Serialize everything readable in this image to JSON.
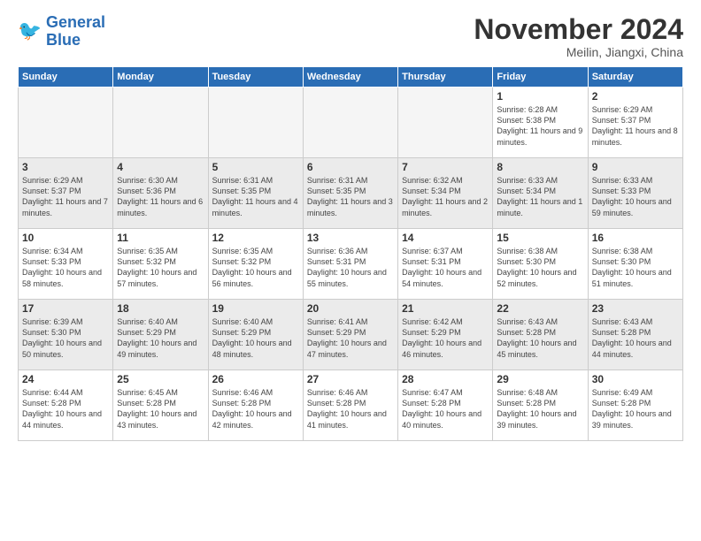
{
  "logo": {
    "line1": "General",
    "line2": "Blue"
  },
  "title": "November 2024",
  "location": "Meilin, Jiangxi, China",
  "weekdays": [
    "Sunday",
    "Monday",
    "Tuesday",
    "Wednesday",
    "Thursday",
    "Friday",
    "Saturday"
  ],
  "weeks": [
    [
      {
        "day": "",
        "text": ""
      },
      {
        "day": "",
        "text": ""
      },
      {
        "day": "",
        "text": ""
      },
      {
        "day": "",
        "text": ""
      },
      {
        "day": "",
        "text": ""
      },
      {
        "day": "1",
        "text": "Sunrise: 6:28 AM\nSunset: 5:38 PM\nDaylight: 11 hours and 9 minutes."
      },
      {
        "day": "2",
        "text": "Sunrise: 6:29 AM\nSunset: 5:37 PM\nDaylight: 11 hours and 8 minutes."
      }
    ],
    [
      {
        "day": "3",
        "text": "Sunrise: 6:29 AM\nSunset: 5:37 PM\nDaylight: 11 hours and 7 minutes."
      },
      {
        "day": "4",
        "text": "Sunrise: 6:30 AM\nSunset: 5:36 PM\nDaylight: 11 hours and 6 minutes."
      },
      {
        "day": "5",
        "text": "Sunrise: 6:31 AM\nSunset: 5:35 PM\nDaylight: 11 hours and 4 minutes."
      },
      {
        "day": "6",
        "text": "Sunrise: 6:31 AM\nSunset: 5:35 PM\nDaylight: 11 hours and 3 minutes."
      },
      {
        "day": "7",
        "text": "Sunrise: 6:32 AM\nSunset: 5:34 PM\nDaylight: 11 hours and 2 minutes."
      },
      {
        "day": "8",
        "text": "Sunrise: 6:33 AM\nSunset: 5:34 PM\nDaylight: 11 hours and 1 minute."
      },
      {
        "day": "9",
        "text": "Sunrise: 6:33 AM\nSunset: 5:33 PM\nDaylight: 10 hours and 59 minutes."
      }
    ],
    [
      {
        "day": "10",
        "text": "Sunrise: 6:34 AM\nSunset: 5:33 PM\nDaylight: 10 hours and 58 minutes."
      },
      {
        "day": "11",
        "text": "Sunrise: 6:35 AM\nSunset: 5:32 PM\nDaylight: 10 hours and 57 minutes."
      },
      {
        "day": "12",
        "text": "Sunrise: 6:35 AM\nSunset: 5:32 PM\nDaylight: 10 hours and 56 minutes."
      },
      {
        "day": "13",
        "text": "Sunrise: 6:36 AM\nSunset: 5:31 PM\nDaylight: 10 hours and 55 minutes."
      },
      {
        "day": "14",
        "text": "Sunrise: 6:37 AM\nSunset: 5:31 PM\nDaylight: 10 hours and 54 minutes."
      },
      {
        "day": "15",
        "text": "Sunrise: 6:38 AM\nSunset: 5:30 PM\nDaylight: 10 hours and 52 minutes."
      },
      {
        "day": "16",
        "text": "Sunrise: 6:38 AM\nSunset: 5:30 PM\nDaylight: 10 hours and 51 minutes."
      }
    ],
    [
      {
        "day": "17",
        "text": "Sunrise: 6:39 AM\nSunset: 5:30 PM\nDaylight: 10 hours and 50 minutes."
      },
      {
        "day": "18",
        "text": "Sunrise: 6:40 AM\nSunset: 5:29 PM\nDaylight: 10 hours and 49 minutes."
      },
      {
        "day": "19",
        "text": "Sunrise: 6:40 AM\nSunset: 5:29 PM\nDaylight: 10 hours and 48 minutes."
      },
      {
        "day": "20",
        "text": "Sunrise: 6:41 AM\nSunset: 5:29 PM\nDaylight: 10 hours and 47 minutes."
      },
      {
        "day": "21",
        "text": "Sunrise: 6:42 AM\nSunset: 5:29 PM\nDaylight: 10 hours and 46 minutes."
      },
      {
        "day": "22",
        "text": "Sunrise: 6:43 AM\nSunset: 5:28 PM\nDaylight: 10 hours and 45 minutes."
      },
      {
        "day": "23",
        "text": "Sunrise: 6:43 AM\nSunset: 5:28 PM\nDaylight: 10 hours and 44 minutes."
      }
    ],
    [
      {
        "day": "24",
        "text": "Sunrise: 6:44 AM\nSunset: 5:28 PM\nDaylight: 10 hours and 44 minutes."
      },
      {
        "day": "25",
        "text": "Sunrise: 6:45 AM\nSunset: 5:28 PM\nDaylight: 10 hours and 43 minutes."
      },
      {
        "day": "26",
        "text": "Sunrise: 6:46 AM\nSunset: 5:28 PM\nDaylight: 10 hours and 42 minutes."
      },
      {
        "day": "27",
        "text": "Sunrise: 6:46 AM\nSunset: 5:28 PM\nDaylight: 10 hours and 41 minutes."
      },
      {
        "day": "28",
        "text": "Sunrise: 6:47 AM\nSunset: 5:28 PM\nDaylight: 10 hours and 40 minutes."
      },
      {
        "day": "29",
        "text": "Sunrise: 6:48 AM\nSunset: 5:28 PM\nDaylight: 10 hours and 39 minutes."
      },
      {
        "day": "30",
        "text": "Sunrise: 6:49 AM\nSunset: 5:28 PM\nDaylight: 10 hours and 39 minutes."
      }
    ]
  ]
}
